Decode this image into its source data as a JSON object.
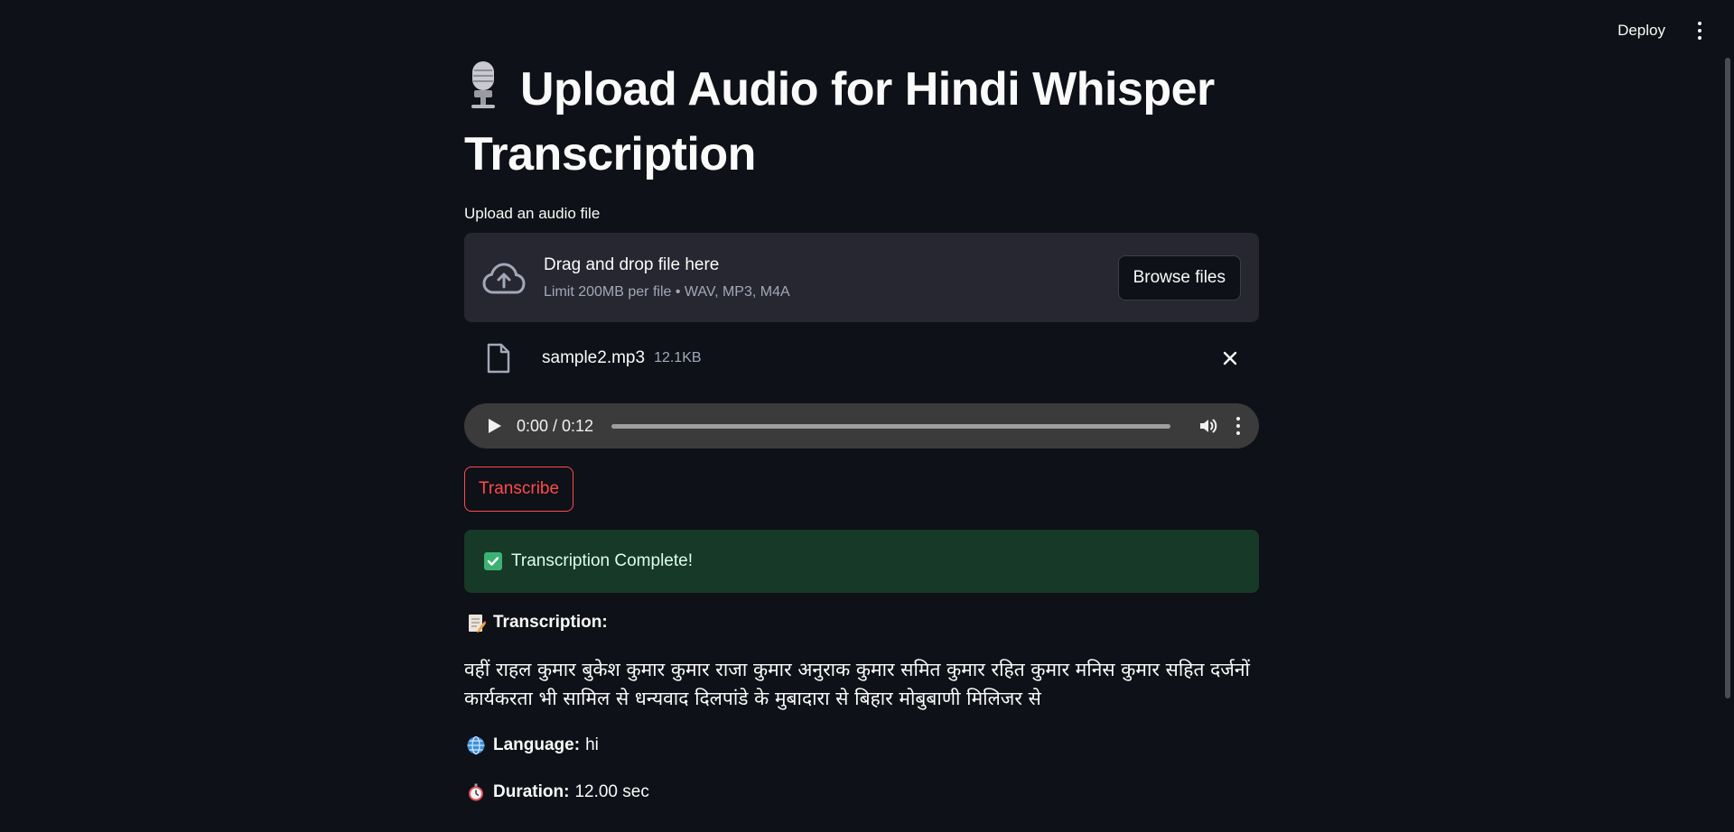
{
  "header": {
    "deploy_label": "Deploy",
    "menu_icon": "kebab-menu-icon"
  },
  "page": {
    "title_icon": "microphone-icon",
    "title": "Upload Audio for Hindi Whisper Transcription"
  },
  "uploader": {
    "label": "Upload an audio file",
    "dropzone_title": "Drag and drop file here",
    "dropzone_limit": "Limit 200MB per file • WAV, MP3, M4A",
    "browse_label": "Browse files",
    "upload_icon": "cloud-upload-icon"
  },
  "uploaded_file": {
    "name": "sample2.mp3",
    "size": "12.1KB",
    "file_icon": "file-icon",
    "remove_icon": "close-icon"
  },
  "audio_player": {
    "time_display": "0:00 / 0:12",
    "progress": 0.0
  },
  "actions": {
    "transcribe_label": "Transcribe"
  },
  "status": {
    "success_message": "Transcription Complete!",
    "success_color": "#173928"
  },
  "result": {
    "transcription_label": "Transcription:",
    "transcription_text": "वहीं राहल कुमार बुकेश कुमार कुमार राजा कुमार अनुराक कुमार समित कुमार रहित कुमार मनिस कुमार सहित दर्जनों कार्यकरता भी सामिल से धन्यवाद दिलपांडे के मुबादारा से बिहार मोबुबाणी मिलिजर से",
    "language_label": "Language:",
    "language_value": "hi",
    "duration_label": "Duration:",
    "duration_value": "12.00 sec"
  },
  "colors": {
    "background": "#0e1117",
    "accent": "#ff4b4b",
    "surface": "#262730"
  }
}
